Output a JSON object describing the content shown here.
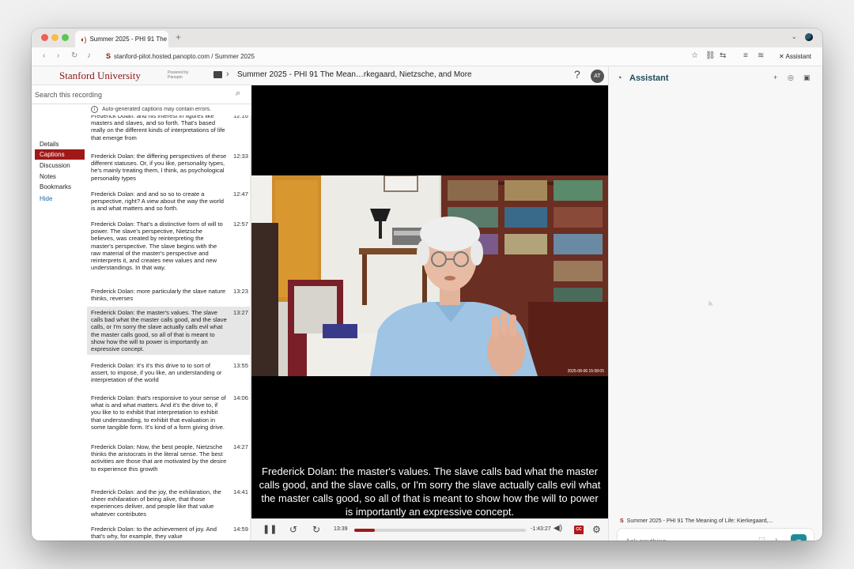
{
  "browser": {
    "tab_title": "Summer 2025 - PHI 91 The",
    "new_tab": "+",
    "url": "stanford-pilot.hosted.panopto.com / Summer 2025",
    "assistant_label": "Assistant"
  },
  "header": {
    "logo": "Stanford University",
    "powered_by": "Powered by",
    "powered_brand": "Panopto",
    "title": "Summer 2025 - PHI 91 The Mean…rkegaard, Nietzsche, and More",
    "help": "?",
    "avatar": "AT"
  },
  "search": {
    "placeholder": "Search this recording"
  },
  "nav": {
    "items": [
      "Details",
      "Captions",
      "Discussion",
      "Notes",
      "Bookmarks"
    ],
    "hide": "Hide",
    "active": "Captions"
  },
  "captions": {
    "notice": "Auto-generated captions may contain errors.",
    "items": [
      {
        "text": "Frederick Dolan: and his interest in figures like masters and slaves, and so forth. That's based really on the different kinds of interpretations of life that emerge from",
        "time": "12:16"
      },
      {
        "text": "Frederick Dolan: the differing perspectives of these different statuses. Or, if you like, personality types, he's mainly treating them, I think, as psychological personality types",
        "time": "12:33"
      },
      {
        "text": "Frederick Dolan: and and so so to create a perspective, right? A view about the way the world is and what matters and so forth.",
        "time": "12:47"
      },
      {
        "text": "Frederick Dolan: That's a distinctive form of will to power. The slave's perspective, Nietzsche believes, was created by reinterpreting the master's perspective. The slave begins with the raw material of the master's perspective and reinterprets it, and creates new values and new understandings. In that way.",
        "time": "12:57"
      },
      {
        "text": "Frederick Dolan: more particularly the slave nature thinks, reverses",
        "time": "13:23"
      },
      {
        "text": "Frederick Dolan: the master's values. The slave calls bad what the master calls good, and the slave calls, or I'm sorry the slave actually calls evil what the master calls good, so all of that is meant to show how the will to power is importantly an expressive concept.",
        "time": "13:27"
      },
      {
        "text": "Frederick Dolan: It's it's this drive to to sort of assert, to impose, if you like, an understanding or interpretation of the world",
        "time": "13:55"
      },
      {
        "text": "Frederick Dolan: that's responsive to your sense of what is and what matters. And it's the drive to, if you like to to exhibit that interpretation to exhibit that understanding, to exhibit that evaluation in some tangible form. It's kind of a form giving drive.",
        "time": "14:06"
      },
      {
        "text": "Frederick Dolan: Now, the best people, Nietzsche thinks the aristocrats in the literal sense. The best activities are those that are motivated by the desire to experience this growth",
        "time": "14:27"
      },
      {
        "text": "Frederick Dolan: and the joy, the exhilaration, the sheer exhilaration of being alive, that those experiences deliver, and people like that value whatever contributes",
        "time": "14:41"
      },
      {
        "text": "Frederick Dolan: to the achievement of joy. And that's why, for example, they value",
        "time": "14:59"
      }
    ]
  },
  "video": {
    "subtitle": "Frederick Dolan: the master's values. The slave calls bad what the master calls good, and the slave calls, or I'm sorry the slave actually calls evil what the master calls good, so all of that is meant to show how the will to power is importantly an expressive concept.",
    "timestamp_overlay": "2025-08-06 15:08:05"
  },
  "player": {
    "current_time": "13:39",
    "remaining_time": "-1:43:27",
    "progress_fraction": 0.12,
    "cc_label": "CC"
  },
  "assistant": {
    "title": "Assistant",
    "context": "Summer 2025 - PHI 91 The Meaning of Life: Kierkegaard,...",
    "placeholder": "Ask anything..."
  },
  "colors": {
    "brand": "#8c1515",
    "accent": "#a01818",
    "assistant_accent": "#1e8c96"
  }
}
